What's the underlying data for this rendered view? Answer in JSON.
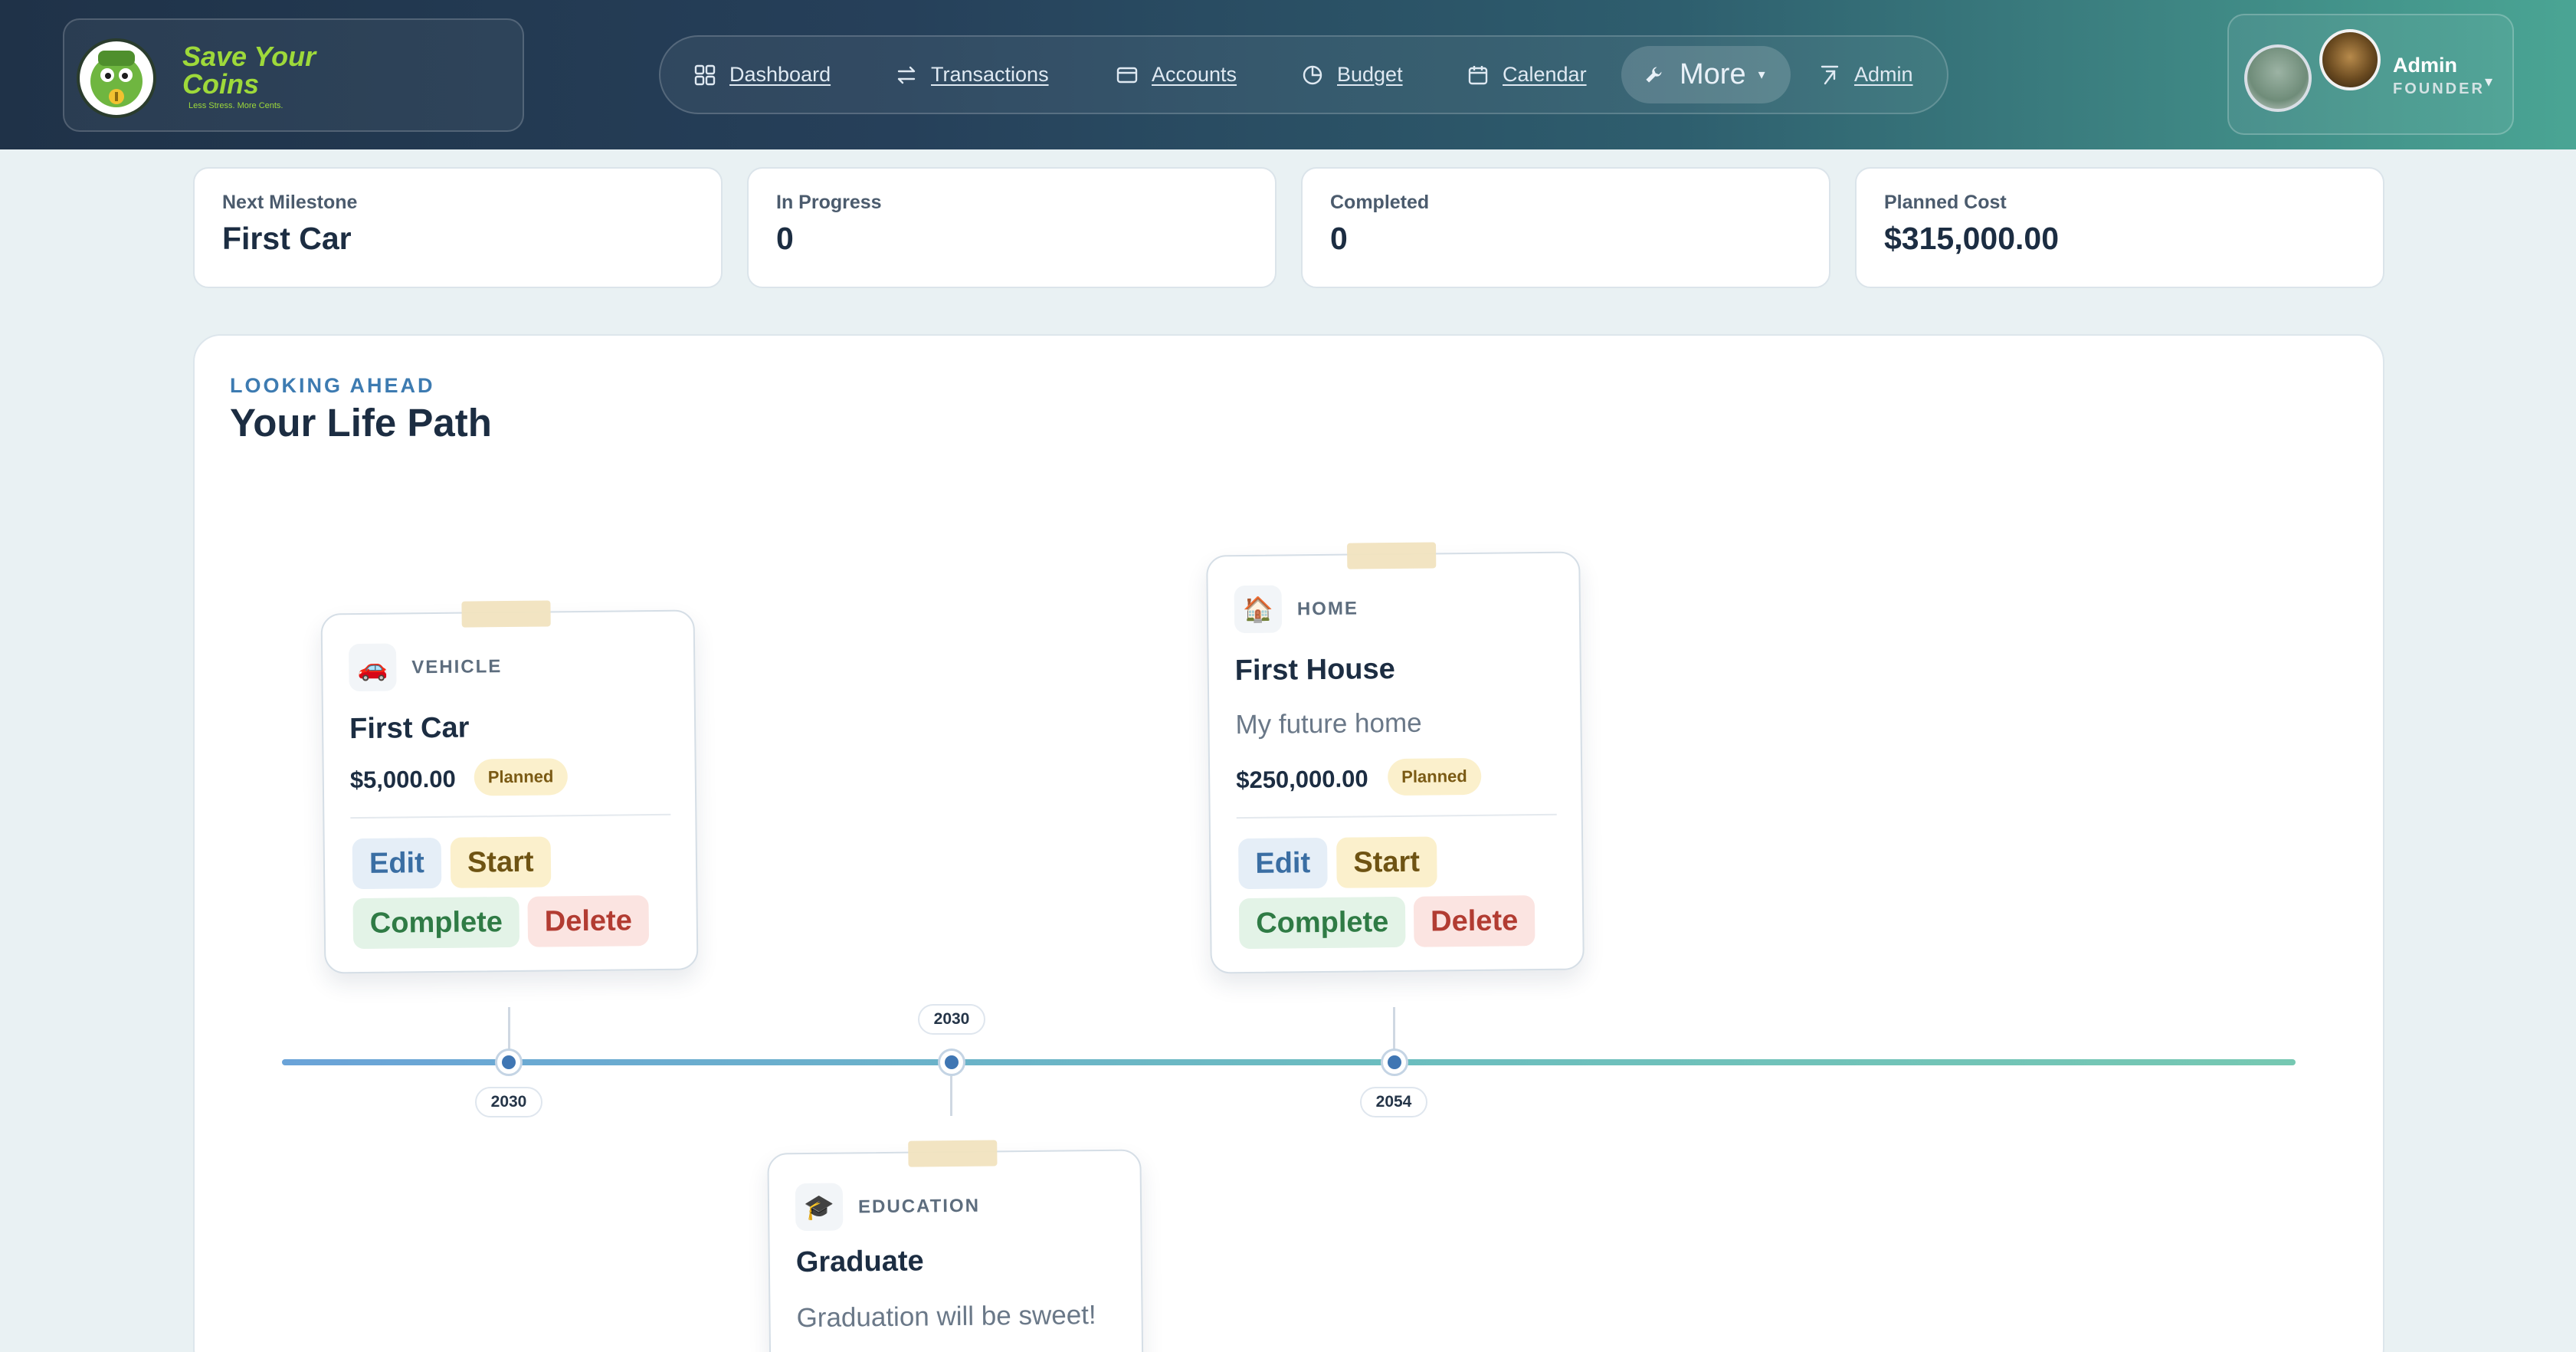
{
  "header": {
    "brand": {
      "name": "Save Your Coins",
      "tagline": "Less Stress. More Cents."
    },
    "nav": [
      {
        "label": "Dashboard",
        "icon": "grid-icon"
      },
      {
        "label": "Transactions",
        "icon": "arrows-swap-icon"
      },
      {
        "label": "Accounts",
        "icon": "wallet-icon"
      },
      {
        "label": "Budget",
        "icon": "pie-icon"
      },
      {
        "label": "Calendar",
        "icon": "calendar-icon"
      },
      {
        "label": "More",
        "icon": "wrench-icon"
      },
      {
        "label": "Admin",
        "icon": "admin-arrow-icon"
      }
    ],
    "profile": {
      "name": "Admin",
      "role": "FOUNDER",
      "caret": "▾"
    }
  },
  "stats": [
    {
      "label": "Next Milestone",
      "value": "First Car"
    },
    {
      "label": "In Progress",
      "value": "0"
    },
    {
      "label": "Completed",
      "value": "0"
    },
    {
      "label": "Planned Cost",
      "value": "$315,000.00"
    }
  ],
  "panel": {
    "eyebrow": "LOOKING AHEAD",
    "title": "Your Life Path"
  },
  "timeline": {
    "years": [
      "2030",
      "2030",
      "2054"
    ]
  },
  "milestones": [
    {
      "category": "VEHICLE",
      "icon": "car-icon",
      "title": "First Car",
      "description": "",
      "amount": "$5,000.00",
      "status": "Planned"
    },
    {
      "category": "EDUCATION",
      "icon": "graduation-cap-icon",
      "title": "Graduate",
      "description": "Graduation will be sweet!",
      "amount": "",
      "status": ""
    },
    {
      "category": "HOME",
      "icon": "house-icon",
      "title": "First House",
      "description": "My future home",
      "amount": "$250,000.00",
      "status": "Planned"
    }
  ],
  "actions": {
    "edit": "Edit",
    "start": "Start",
    "complete": "Complete",
    "delete": "Delete"
  },
  "colors": {
    "accent": "#3d7bb1",
    "header_start": "#1f3248",
    "header_end": "#4aa594",
    "planned_badge": "#fbf0cc"
  }
}
